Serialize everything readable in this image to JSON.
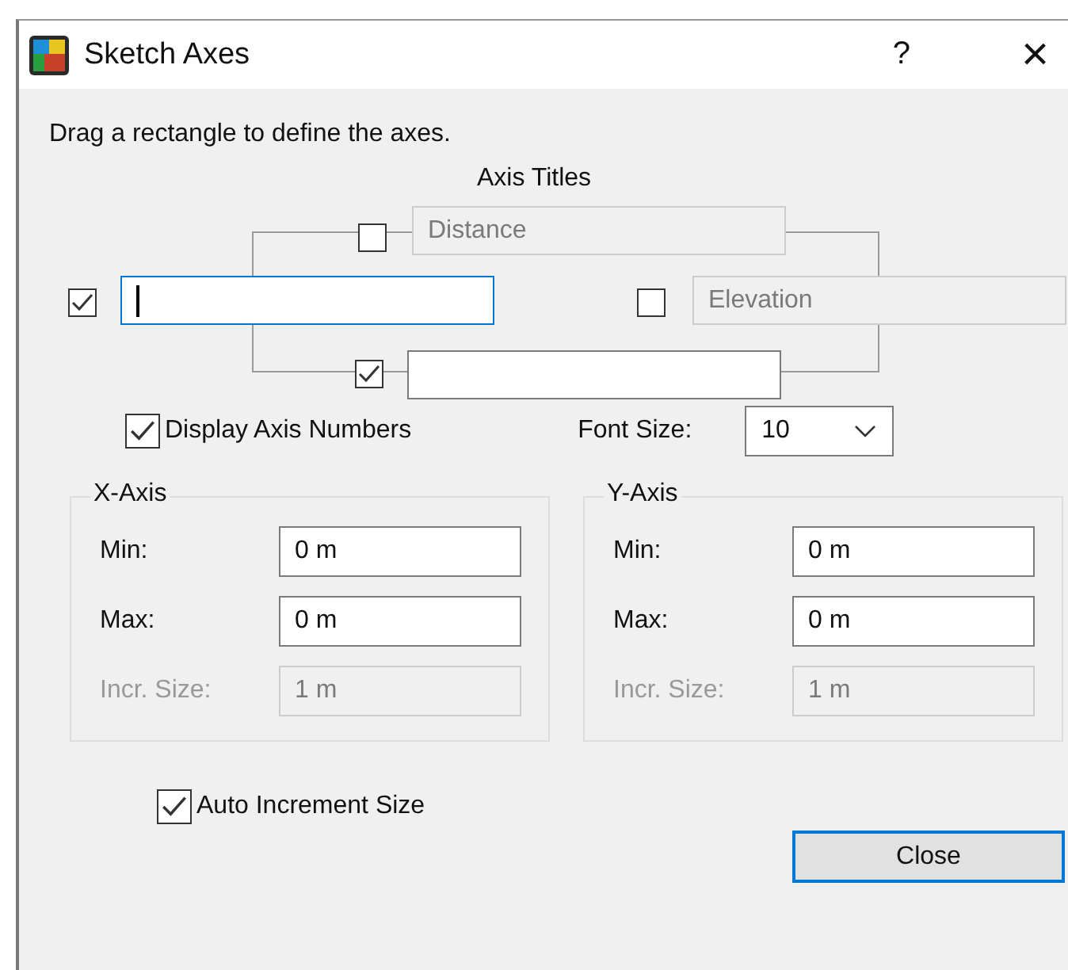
{
  "window": {
    "title": "Sketch Axes",
    "help": "?",
    "close": "×"
  },
  "instruction": "Drag a rectangle to define the axes.",
  "axis_titles": {
    "heading": "Axis Titles",
    "items": [
      {
        "kind": "top",
        "checked": false,
        "value": "Distance",
        "disabled": true,
        "focused": false
      },
      {
        "kind": "left",
        "checked": true,
        "disabled": false,
        "focused": true
      },
      {
        "kind": "right",
        "checked": false,
        "value": "Elevation",
        "disabled": true,
        "focused": false
      },
      {
        "kind": "bottom",
        "checked": true,
        "disabled": false,
        "focused": false
      }
    ]
  },
  "display_axis_numbers": {
    "label": "Display Axis Numbers",
    "checked": true
  },
  "font_size": {
    "label": "Font Size:",
    "value": "10"
  },
  "groups": [
    {
      "title": "X-Axis",
      "fields": [
        {
          "label": "Min:",
          "value": "0 m",
          "disabled": false
        },
        {
          "label": "Max:",
          "value": "0 m",
          "disabled": false
        },
        {
          "label": "Incr. Size:",
          "value": "1 m",
          "disabled": true
        }
      ]
    },
    {
      "title": "Y-Axis",
      "fields": [
        {
          "label": "Min:",
          "value": "0 m",
          "disabled": false
        },
        {
          "label": "Max:",
          "value": "0 m",
          "disabled": false
        },
        {
          "label": "Incr. Size:",
          "value": "1 m",
          "disabled": true
        }
      ]
    }
  ],
  "auto_increment": {
    "label": "Auto Increment Size",
    "checked": true
  },
  "buttons": [
    {
      "label": "Close",
      "default": true
    }
  ]
}
